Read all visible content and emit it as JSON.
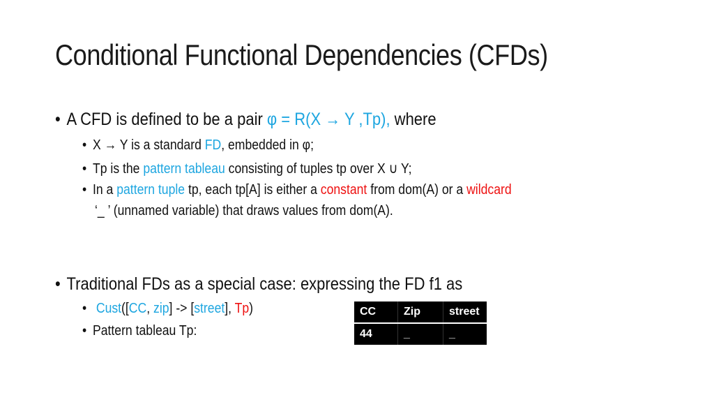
{
  "slide": {
    "title": "Conditional Functional Dependencies (CFDs)",
    "bullet_glyph": "•",
    "section1": {
      "line_parts": [
        "A CFD is defined to be a pair ",
        "φ = R(X → Y ,Tp),",
        " where"
      ],
      "sub1_parts": [
        "X → Y is a standard ",
        "FD",
        ", embedded in φ;"
      ],
      "sub2_parts": [
        "Tp is the ",
        "pattern tableau",
        " consisting of tuples tp over X ∪ Y;"
      ],
      "sub3_parts": [
        "In a ",
        "pattern tuple",
        " tp, each tp[A] is either a ",
        "constant",
        " from dom(A) or a ",
        "wildcard"
      ],
      "sub3_cont": "‘_ ’ (unnamed variable) that draws values from dom(A)."
    },
    "section2": {
      "line": "Traditional FDs as a special case: expressing the FD f1 as",
      "sub1_parts": [
        "Cust",
        "([",
        "CC",
        ", ",
        "zip",
        "] -> [",
        "street",
        "], ",
        "Tp",
        ")"
      ],
      "sub2": "Pattern tableau Tp:"
    },
    "tableau": {
      "headers": [
        "CC",
        "Zip",
        "street"
      ],
      "rows": [
        [
          "44",
          "_",
          "_"
        ]
      ]
    },
    "colors": {
      "accent_blue": "#1ea6e0",
      "accent_red": "#ee1111",
      "text": "#111111"
    }
  }
}
